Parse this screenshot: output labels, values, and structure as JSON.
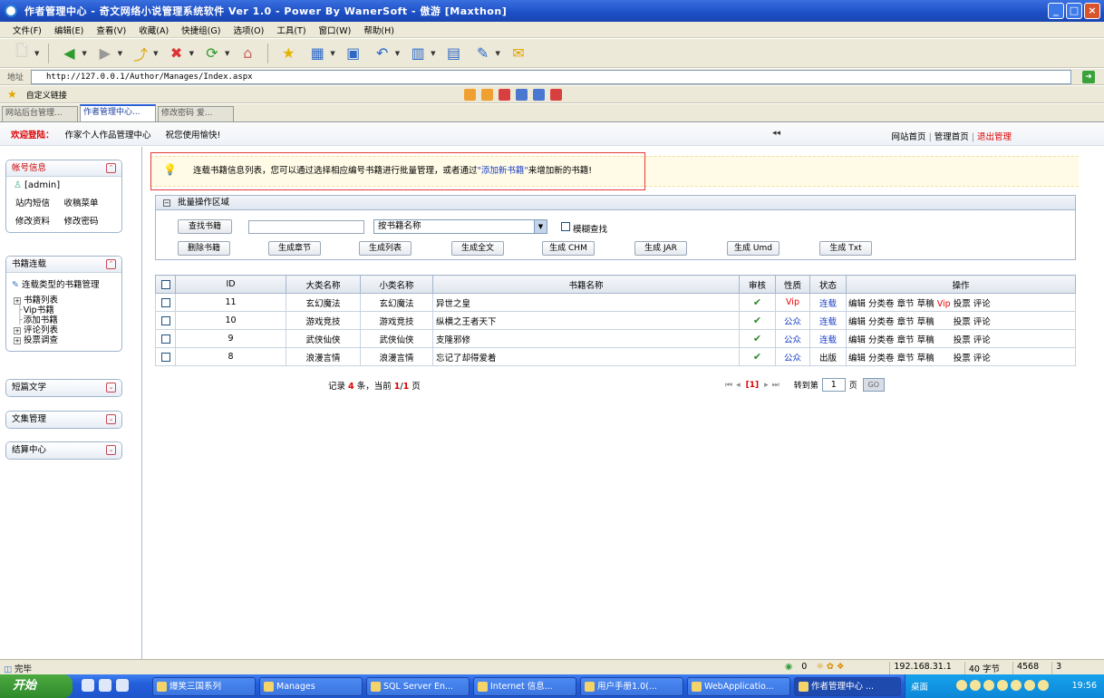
{
  "window": {
    "title": "作者管理中心 - 奇文网络小说管理系统软件 Ver 1.0 - Power By WanerSoft - 傲游 [Maxthon]",
    "buttons": [
      "_",
      "□",
      "×"
    ]
  },
  "menu": [
    "文件(F)",
    "编辑(E)",
    "查看(V)",
    "收藏(A)",
    "快捷组(G)",
    "选项(O)",
    "工具(T)",
    "窗口(W)",
    "帮助(H)"
  ],
  "address": {
    "label": "地址",
    "url": "http://127.0.0.1/Author/Manages/Index.aspx"
  },
  "links_bar": {
    "label": "自定义链接"
  },
  "browser_tabs": [
    {
      "label": "网站后台管理..."
    },
    {
      "label": "作者管理中心..."
    },
    {
      "label": "修改密码 爱..."
    }
  ],
  "welcome": {
    "hello": "欢迎登陆：",
    "center": "作家个人作品管理中心",
    "wish": "祝您使用愉快!",
    "collapse": "◂◂",
    "links": [
      "网站首页",
      "管理首页",
      "退出管理"
    ]
  },
  "sidebar": {
    "account": {
      "title": "帐号信息",
      "user": "[admin]",
      "links": [
        "站内短信",
        "收稿菜单",
        "修改资料",
        "修改密码"
      ]
    },
    "books": {
      "title": "书籍连载",
      "subtitle": "连载类型的书籍管理",
      "tree": [
        {
          "label": "书籍列表",
          "expandable": true
        },
        {
          "label": "Vip书籍",
          "expandable": false
        },
        {
          "label": "添加书籍",
          "expandable": false
        },
        {
          "label": "评论列表",
          "expandable": true
        },
        {
          "label": "投票调查",
          "expandable": true
        }
      ]
    },
    "collapsed_panels": [
      "短篇文学",
      "文集管理",
      "结算中心"
    ]
  },
  "notice": {
    "text_before": "连载书籍信息列表，您可以通过选择相应编号书籍进行批量管理，或者通过",
    "link": "\"添加新书籍\"",
    "text_after": "来增加新的书籍!"
  },
  "batch": {
    "title": "批量操作区域",
    "search_button": "查找书籍",
    "search_value": "",
    "select_value": "按书籍名称",
    "fuzzy_label": "模糊查找",
    "buttons": [
      "删除书籍",
      "生成章节",
      "生成列表",
      "生成全文",
      "生成 CHM",
      "生成 JAR",
      "生成 Umd",
      "生成 Txt"
    ]
  },
  "table": {
    "headers": [
      "",
      "ID",
      "大类名称",
      "小类名称",
      "书籍名称",
      "审核",
      "性质",
      "状态",
      "操作"
    ],
    "rows": [
      {
        "id": "11",
        "major": "玄幻魔法",
        "minor": "玄幻魔法",
        "name": "异世之皇",
        "audit": "✔",
        "nature": "Vip",
        "status": "连载",
        "ops": [
          "编辑",
          "分类卷",
          "章节",
          "草稿",
          "Vip",
          "投票",
          "评论"
        ]
      },
      {
        "id": "10",
        "major": "游戏竞技",
        "minor": "游戏竞技",
        "name": "纵横之王者天下",
        "audit": "✔",
        "nature": "公众",
        "status": "连载",
        "ops": [
          "编辑",
          "分类卷",
          "章节",
          "草稿",
          "投票",
          "评论"
        ]
      },
      {
        "id": "9",
        "major": "武侠仙侠",
        "minor": "武侠仙侠",
        "name": "支隆邪修",
        "audit": "✔",
        "nature": "公众",
        "status": "连载",
        "ops": [
          "编辑",
          "分类卷",
          "章节",
          "草稿",
          "投票",
          "评论"
        ]
      },
      {
        "id": "8",
        "major": "浪漫言情",
        "minor": "浪漫言情",
        "name": "忘记了却得爱着",
        "audit": "✔",
        "nature": "公众",
        "status": "出版",
        "ops": [
          "编辑",
          "分类卷",
          "章节",
          "草稿",
          "投票",
          "评论"
        ]
      }
    ]
  },
  "footer": {
    "records_label": "记录",
    "records_count": "4",
    "records_unit": "条，当前",
    "page_current": "1",
    "page_total": "1",
    "page_unit": "页",
    "pager_current": "[1]",
    "goto_label": "转到第",
    "goto_value": "1",
    "goto_unit": "页",
    "go_button": "GO"
  },
  "statusbar": {
    "left": "完毕",
    "count": "0",
    "ip": "192.168.31.1",
    "bytes": "40 字节",
    "mem": "4568",
    "extra": "3"
  },
  "taskbar": {
    "start": "开始",
    "tasks": [
      "爆笑三国系列",
      "Manages",
      "SQL Server En...",
      "Internet 信息...",
      "用户手册1.0(...",
      "WebApplicatio...",
      "作者管理中心 ..."
    ],
    "desktop": "桌面",
    "clock": "19:56"
  }
}
